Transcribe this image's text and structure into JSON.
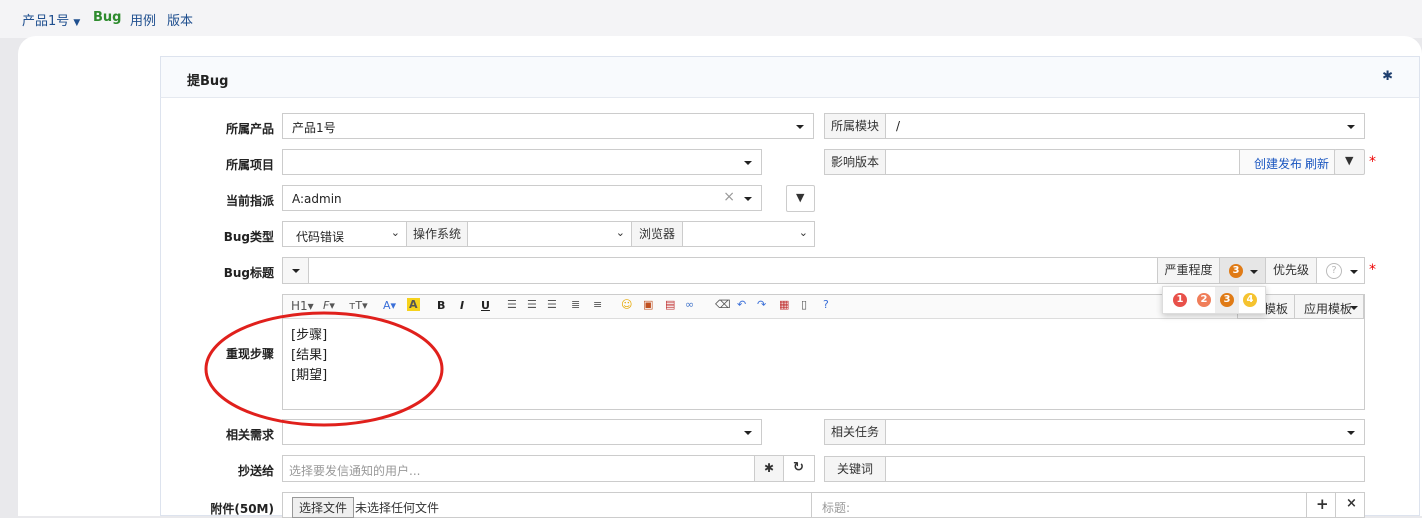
{
  "nav": {
    "product": "产品1号",
    "bug": "Bug",
    "case": "用例",
    "version": "版本"
  },
  "panel": {
    "title": "提Bug"
  },
  "form": {
    "product_label": "所属产品",
    "product_value": "产品1号",
    "module_label": "所属模块",
    "module_value": "/",
    "project_label": "所属项目",
    "build_label": "影响版本",
    "create_build": "创建发布",
    "refresh": "刷新",
    "assign_label": "当前指派",
    "assign_value": "A:admin",
    "type_label": "Bug类型",
    "type_value": "代码错误",
    "os_label": "操作系统",
    "browser_label": "浏览器",
    "title_label": "Bug标题",
    "severity_label": "严重程度",
    "severity_value": "3",
    "severity_options": [
      "1",
      "2",
      "3",
      "4"
    ],
    "priority_label": "优先级",
    "priority_value": "?",
    "steps_label": "重现步骤",
    "steps": [
      "[步骤]",
      "[结果]",
      "[期望]"
    ],
    "template_save": "模板",
    "template_apply": "应用模板",
    "story_label": "相关需求",
    "task_label": "相关任务",
    "mailto_label": "抄送给",
    "mailto_placeholder": "选择要发信通知的用户...",
    "keywords_label": "关键词",
    "files_label": "附件(50M)",
    "choose_file": "选择文件",
    "no_file": "未选择任何文件",
    "file_title_placeholder": "标题:"
  },
  "toolbar": {
    "h1": "H1",
    "font": "F",
    "size": "T",
    "bold": "B",
    "italic": "I",
    "underline": "U"
  },
  "colors": {
    "accent": "#1a56c0",
    "severity_1": "#e8514a",
    "severity_2": "#f07e5a",
    "severity_3": "#e07b16",
    "severity_4": "#f5c330",
    "annotation": "#e0201c"
  }
}
